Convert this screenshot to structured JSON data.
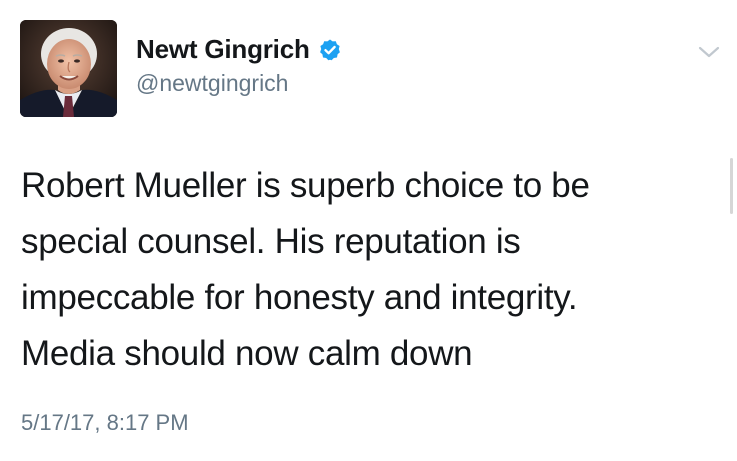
{
  "author": {
    "display_name": "Newt Gingrich",
    "handle": "@newtgingrich",
    "verified": true,
    "avatar_icon": "user-avatar-photo"
  },
  "tweet": {
    "lines": [
      "Robert Mueller is superb choice to be",
      "special counsel. His reputation is",
      "impeccable for honesty and integrity.",
      "Media should now calm down"
    ],
    "timestamp": "5/17/17, 8:17 PM"
  },
  "icons": {
    "verified": "verified-badge-icon",
    "menu": "chevron-down-icon"
  },
  "colors": {
    "text": "#14171a",
    "secondary": "#657786",
    "verified_blue": "#1da1f2"
  }
}
